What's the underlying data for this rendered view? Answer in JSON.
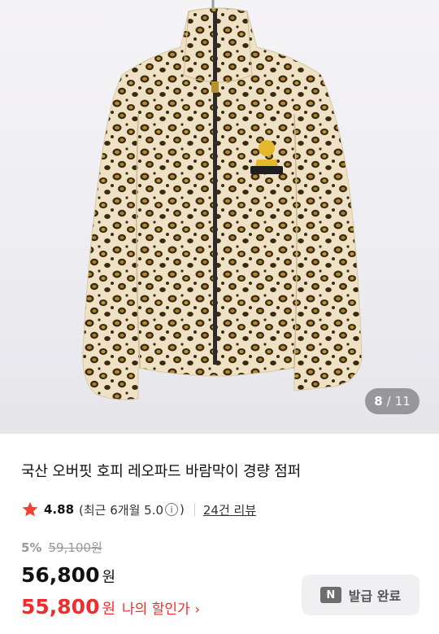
{
  "gallery": {
    "current": "8",
    "separator": "/",
    "total": "11"
  },
  "product": {
    "title": "국산 오버핏 호피 레오파드 바람막이 경량 점퍼",
    "rating": "4.88",
    "rating_detail_prefix": "(최근 6개월 5.0",
    "rating_detail_suffix": ")",
    "info_glyph": "i",
    "review_link": "24건 리뷰",
    "discount_percent": "5%",
    "original_price": "59,100원",
    "price": "56,800",
    "price_unit": "원",
    "my_price": "55,800",
    "my_price_unit": "원",
    "my_price_label": "나의 할인가",
    "my_price_chevron": "›"
  },
  "coupon": {
    "badge": "N",
    "label": "발급 완료"
  },
  "colors": {
    "accent_red": "#f12c2c",
    "star_red": "#f4402f",
    "muted_gray": "#999999"
  },
  "icons": {
    "star": "star-icon",
    "info": "info-icon",
    "chevron": "chevron-right-icon",
    "naver": "naver-n-icon"
  }
}
